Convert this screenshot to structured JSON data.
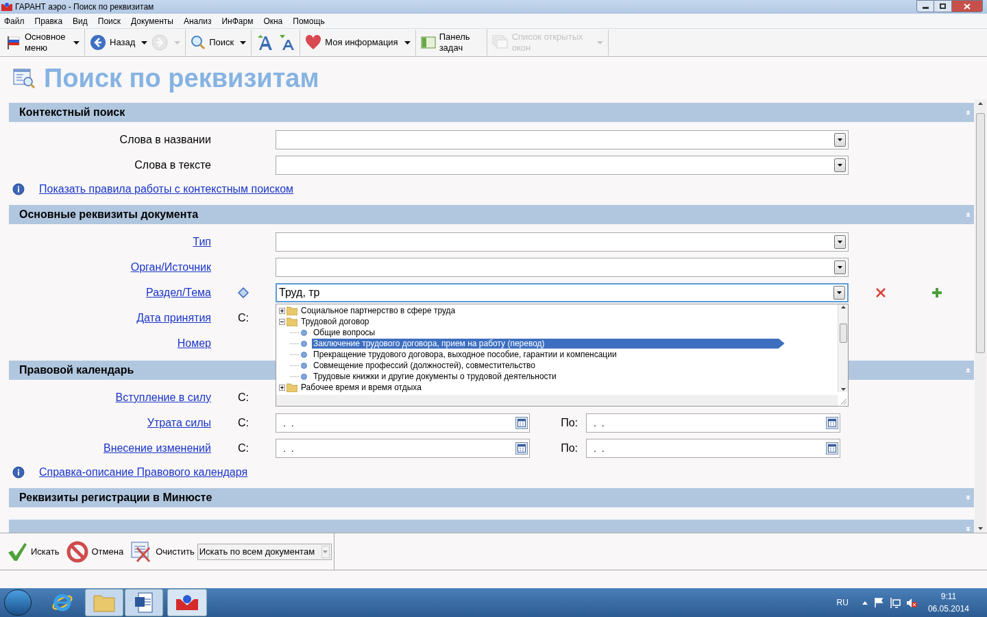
{
  "window": {
    "title": "ГАРАНТ аэро - Поиск по реквизитам"
  },
  "menu": [
    "Файл",
    "Правка",
    "Вид",
    "Поиск",
    "Документы",
    "Анализ",
    "ИнФарм",
    "Окна",
    "Помощь"
  ],
  "toolbar": [
    {
      "kind": "button",
      "label": "Основное меню",
      "dropdown": true,
      "disabled": false
    },
    {
      "kind": "button",
      "label": "Назад",
      "dropdown": true,
      "disabled": false
    },
    {
      "kind": "icon",
      "dropdown": true,
      "disabled": true
    },
    {
      "kind": "button",
      "label": "Поиск",
      "dropdown": true,
      "disabled": false
    },
    {
      "kind": "icon",
      "dropdown": false,
      "disabled": false
    },
    {
      "kind": "icon",
      "dropdown": false,
      "disabled": false
    },
    {
      "kind": "button",
      "label": "Моя информация",
      "dropdown": true,
      "disabled": false
    },
    {
      "kind": "button",
      "label": "Панель задач",
      "dropdown": false,
      "disabled": false
    },
    {
      "kind": "button",
      "label": "Список открытых окон",
      "dropdown": true,
      "disabled": true
    }
  ],
  "page_title": "Поиск по реквизитам",
  "sections": [
    {
      "title": "Контекстный поиск",
      "expanded": true,
      "rows": [
        {
          "kind": "combo",
          "label": "Слова в названии",
          "link": false,
          "value": ""
        },
        {
          "kind": "combo",
          "label": "Слова в тексте",
          "link": false,
          "value": ""
        },
        {
          "kind": "info",
          "text": "Показать правила работы с контекстным поиском"
        }
      ]
    },
    {
      "title": "Основные реквизиты документа",
      "expanded": true,
      "rows": [
        {
          "kind": "combo",
          "label": "Тип",
          "link": true,
          "value": ""
        },
        {
          "kind": "combo",
          "label": "Орган/Источник",
          "link": true,
          "value": ""
        },
        {
          "kind": "combo_tree",
          "label": "Раздел/Тема",
          "link": true,
          "value": "Труд, тр",
          "focused": true
        },
        {
          "kind": "dates",
          "label": "Дата принятия",
          "link": true,
          "from": "С:"
        },
        {
          "kind": "label_only",
          "label": "Номер",
          "link": true
        }
      ]
    },
    {
      "title": "Правовой календарь",
      "expanded": true,
      "rows": [
        {
          "kind": "dates",
          "label": "Вступление в силу",
          "link": true,
          "from": "С:"
        },
        {
          "kind": "dates",
          "label": "Утрата силы",
          "link": true,
          "from": "С:",
          "from_value": ".  .",
          "to": "По:",
          "to_value": ".  ."
        },
        {
          "kind": "dates",
          "label": "Внесение изменений",
          "link": true,
          "from": "С:",
          "from_value": ".  .",
          "to": "По:",
          "to_value": ".  ."
        },
        {
          "kind": "info",
          "text": "Справка-описание Правового календаря"
        }
      ]
    },
    {
      "title": "Реквизиты регистрации в Минюсте",
      "expanded": false
    },
    {
      "expanded": false
    }
  ],
  "dropdown": {
    "open": true,
    "items": [
      {
        "label": "Социальное партнерство в сфере труда",
        "kind": "folder",
        "expanded": false,
        "selected": false
      },
      {
        "label": "Трудовой договор",
        "kind": "folder",
        "expanded": true,
        "selected": false,
        "children": [
          {
            "label": "Общие вопросы",
            "kind": "leaf",
            "selected": false
          },
          {
            "label": "Заключение трудового договора, прием на работу (перевод)",
            "kind": "leaf",
            "selected": true
          },
          {
            "label": "Прекращение трудового договора, выходное пособие, гарантии и компенсации",
            "kind": "leaf",
            "selected": false
          },
          {
            "label": "Совмещение профессий (должностей), совместительство",
            "kind": "leaf",
            "selected": false
          },
          {
            "label": "Трудовые книжки и другие документы о трудовой деятельности",
            "kind": "leaf",
            "selected": false
          }
        ]
      },
      {
        "label": "Рабочее время и время отдыха",
        "kind": "folder",
        "expanded": false,
        "selected": false
      }
    ]
  },
  "bottom_bar": {
    "buttons": [
      "Искать",
      "Отмена",
      "Очистить"
    ],
    "scope": "Искать по всем документам"
  },
  "taskbar": {
    "tray": {
      "language": "RU",
      "time": "9:11",
      "date": "06.05.2014"
    }
  }
}
